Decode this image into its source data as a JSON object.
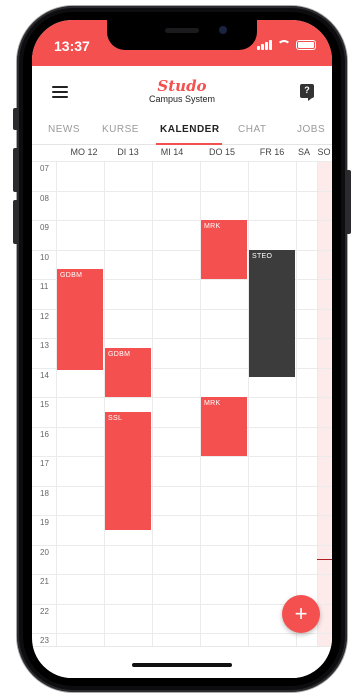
{
  "status": {
    "time": "13:37"
  },
  "app": {
    "logo": "Studo",
    "subtitle": "Campus System",
    "help": "?"
  },
  "tabs": [
    {
      "label": "NEWS",
      "active": false
    },
    {
      "label": "KURSE",
      "active": false
    },
    {
      "label": "KALENDER",
      "active": true
    },
    {
      "label": "CHAT",
      "active": false
    },
    {
      "label": "JOBS",
      "active": false
    }
  ],
  "days": [
    "MO 12",
    "DI 13",
    "MI 14",
    "DO 15",
    "FR 16",
    "SA",
    "SO"
  ],
  "hours": [
    "07",
    "08",
    "09",
    "10",
    "11",
    "12",
    "13",
    "14",
    "15",
    "16",
    "17",
    "18",
    "19",
    "20",
    "21",
    "22",
    "23"
  ],
  "events": [
    {
      "title": "GDBM",
      "day": "MO 12",
      "start": "10:40",
      "end": "14:05",
      "color": "#f4504f"
    },
    {
      "title": "GDBM",
      "day": "DI 13",
      "start": "13:20",
      "end": "15:00",
      "color": "#f4504f"
    },
    {
      "title": "SSL",
      "day": "DI 13",
      "start": "15:30",
      "end": "19:30",
      "color": "#f4504f"
    },
    {
      "title": "MRK",
      "day": "DO 15",
      "start": "09:00",
      "end": "11:00",
      "color": "#f4504f"
    },
    {
      "title": "MRK",
      "day": "DO 15",
      "start": "15:00",
      "end": "17:00",
      "color": "#f4504f"
    },
    {
      "title": "STEO",
      "day": "FR 16",
      "start": "10:00",
      "end": "14:20",
      "color": "#3c3c3c"
    }
  ],
  "fab": {
    "label": "+"
  },
  "colors": {
    "accent": "#f4504f",
    "dark_event": "#3c3c3c",
    "weekend_bg": "#fdeaea"
  }
}
